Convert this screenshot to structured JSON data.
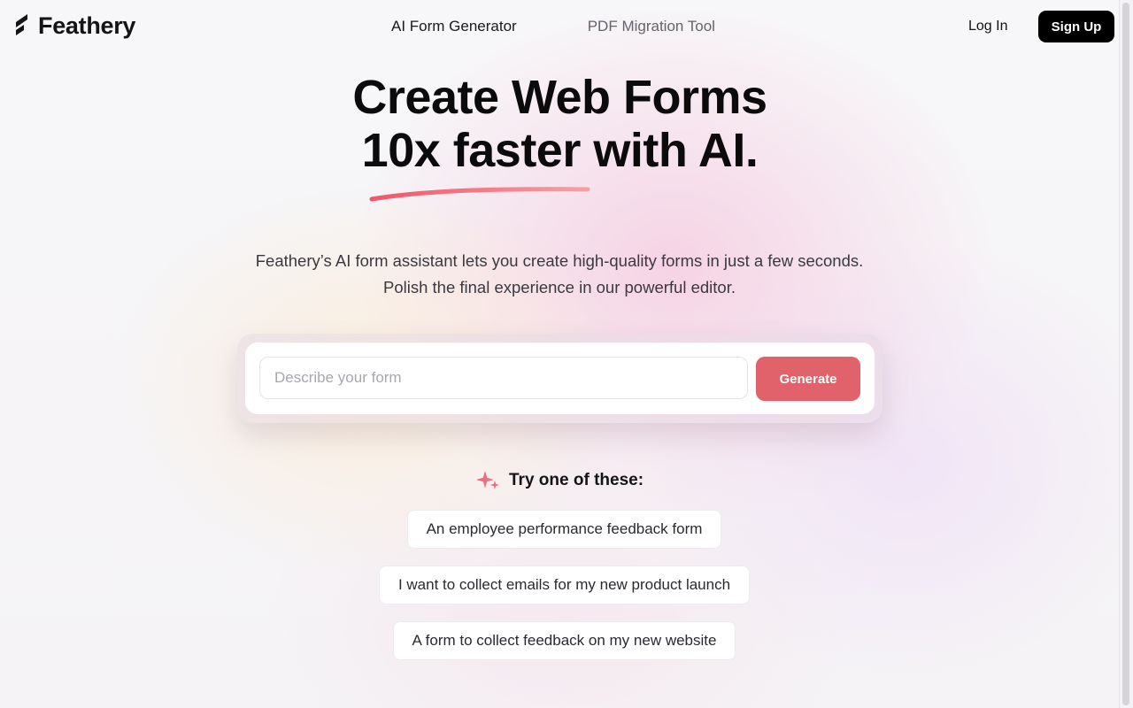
{
  "header": {
    "brand": "Feathery",
    "nav": [
      {
        "label": "AI Form Generator"
      },
      {
        "label": "PDF Migration Tool"
      }
    ],
    "login_label": "Log In",
    "signup_label": "Sign Up"
  },
  "hero": {
    "title_line1": "Create Web Forms",
    "title_line2": "10x faster with AI.",
    "subtitle": "Feathery’s AI form assistant lets you create high-quality forms in just a few seconds. Polish the final experience in our powerful editor."
  },
  "form": {
    "placeholder": "Describe your form",
    "value": "",
    "generate_label": "Generate"
  },
  "suggestions": {
    "heading": "Try one of these:",
    "items": [
      "An employee performance feedback form",
      "I want to collect emails for my new product launch",
      "A form to collect feedback on my new website"
    ]
  },
  "colors": {
    "accent": "#e2626c",
    "dark": "#000000",
    "underline": "#f0566a"
  },
  "icons": {
    "brand": "feather-logo-icon",
    "sparkle": "sparkle-icon"
  }
}
